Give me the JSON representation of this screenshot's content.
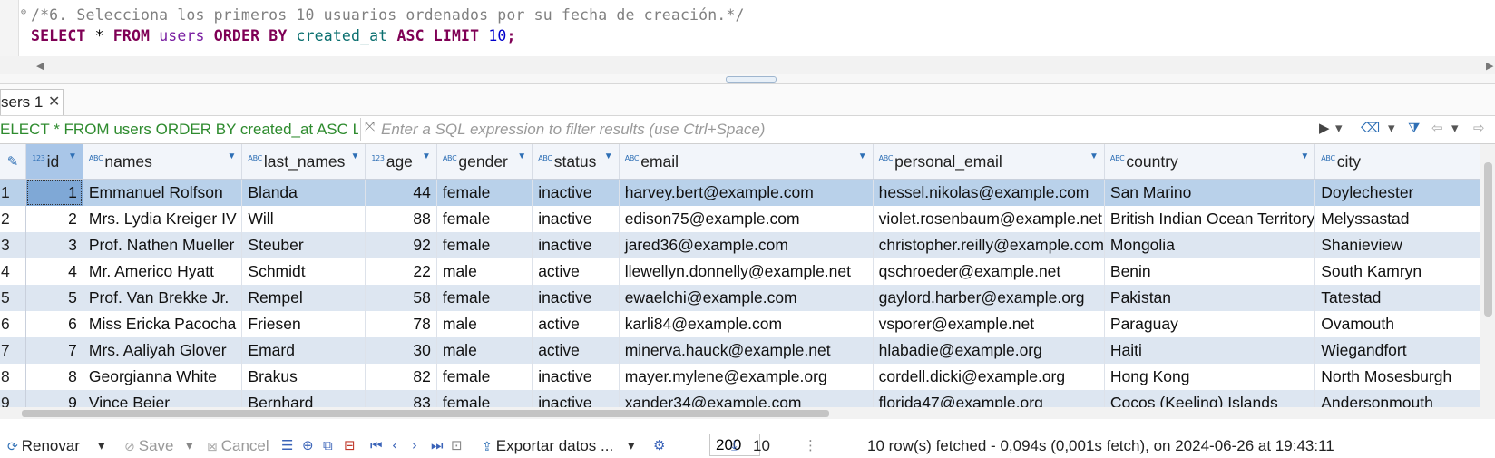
{
  "editor": {
    "comment": "/*6. Selecciona los primeros 10 usuarios ordenados por su fecha de creación.*/",
    "query": {
      "kw_select": "SELECT",
      "star": " * ",
      "kw_from": "FROM",
      "table": "users",
      "kw_order_by": "ORDER BY",
      "column": "created_at",
      "kw_asc": "ASC",
      "kw_limit": "LIMIT",
      "limit_value": "10",
      "terminator": ";"
    }
  },
  "tab": {
    "label": "sers 1",
    "close": "✕"
  },
  "filter": {
    "query_text": "ELECT * FROM users ORDER BY created_at ASC LIMIT 10",
    "placeholder": "Enter a SQL expression to filter results (use Ctrl+Space)"
  },
  "columns": [
    {
      "label": "id",
      "type": "123"
    },
    {
      "label": "names",
      "type": "ABC"
    },
    {
      "label": "last_names",
      "type": "ABC"
    },
    {
      "label": "age",
      "type": "123"
    },
    {
      "label": "gender",
      "type": "ABC"
    },
    {
      "label": "status",
      "type": "ABC"
    },
    {
      "label": "email",
      "type": "ABC"
    },
    {
      "label": "personal_email",
      "type": "ABC"
    },
    {
      "label": "country",
      "type": "ABC"
    },
    {
      "label": "city",
      "type": "ABC"
    }
  ],
  "rows": [
    [
      "1",
      "1",
      "Emmanuel Rolfson",
      "Blanda",
      "44",
      "female",
      "inactive",
      "harvey.bert@example.com",
      "hessel.nikolas@example.com",
      "San Marino",
      "Doylechester"
    ],
    [
      "2",
      "2",
      "Mrs. Lydia Kreiger IV",
      "Will",
      "88",
      "female",
      "inactive",
      "edison75@example.com",
      "violet.rosenbaum@example.net",
      "British Indian Ocean Territory",
      "Melyssastad"
    ],
    [
      "3",
      "3",
      "Prof. Nathen Mueller",
      "Steuber",
      "92",
      "female",
      "inactive",
      "jared36@example.com",
      "christopher.reilly@example.com",
      "Mongolia",
      "Shanieview"
    ],
    [
      "4",
      "4",
      "Mr. Americo Hyatt",
      "Schmidt",
      "22",
      "male",
      "active",
      "llewellyn.donnelly@example.net",
      "qschroeder@example.net",
      "Benin",
      "South Kamryn"
    ],
    [
      "5",
      "5",
      "Prof. Van Brekke Jr.",
      "Rempel",
      "58",
      "female",
      "inactive",
      "ewaelchi@example.com",
      "gaylord.harber@example.org",
      "Pakistan",
      "Tatestad"
    ],
    [
      "6",
      "6",
      "Miss Ericka Pacocha",
      "Friesen",
      "78",
      "male",
      "active",
      "karli84@example.com",
      "vsporer@example.net",
      "Paraguay",
      "Ovamouth"
    ],
    [
      "7",
      "7",
      "Mrs. Aaliyah Glover",
      "Emard",
      "30",
      "male",
      "active",
      "minerva.hauck@example.net",
      "hlabadie@example.org",
      "Haiti",
      "Wiegandfort"
    ],
    [
      "8",
      "8",
      "Georgianna White",
      "Brakus",
      "82",
      "female",
      "inactive",
      "mayer.mylene@example.org",
      "cordell.dicki@example.org",
      "Hong Kong",
      "North Mosesburgh"
    ],
    [
      "9",
      "9",
      "Vince Beier",
      "Bernhard",
      "83",
      "female",
      "inactive",
      "xander34@example.com",
      "florida47@example.org",
      "Cocos (Keeling) Islands",
      "Andersonmouth"
    ]
  ],
  "toolbar": {
    "refresh": "Renovar",
    "save": "Save",
    "cancel": "Cancel",
    "export": "Exportar datos ...",
    "fetch_size": "200",
    "row_count": "10",
    "status": "10 row(s) fetched - 0,094s (0,001s fetch), on 2024-06-26 at 19:43:11"
  }
}
